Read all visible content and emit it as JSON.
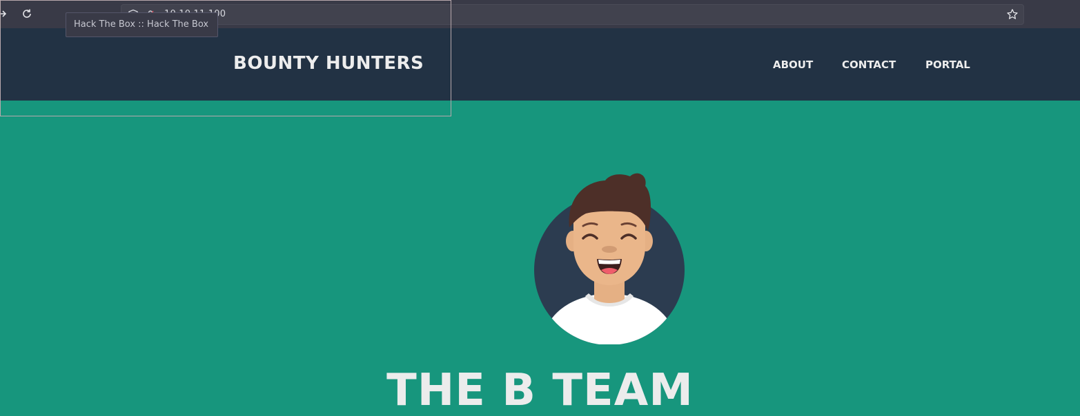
{
  "browser": {
    "url": "10.10.11.100",
    "tooltip": "Hack The Box :: Hack The Box"
  },
  "header": {
    "brand": "BOUNTY HUNTERS",
    "nav": [
      {
        "label": "ABOUT"
      },
      {
        "label": "CONTACT"
      },
      {
        "label": "PORTAL"
      }
    ]
  },
  "hero": {
    "title": "THE B TEAM",
    "avatar_icon": "avatar-icon"
  },
  "colors": {
    "toolbar": "#393a47",
    "header": "#223244",
    "hero_background": "#17967d",
    "text": "#ededed"
  }
}
